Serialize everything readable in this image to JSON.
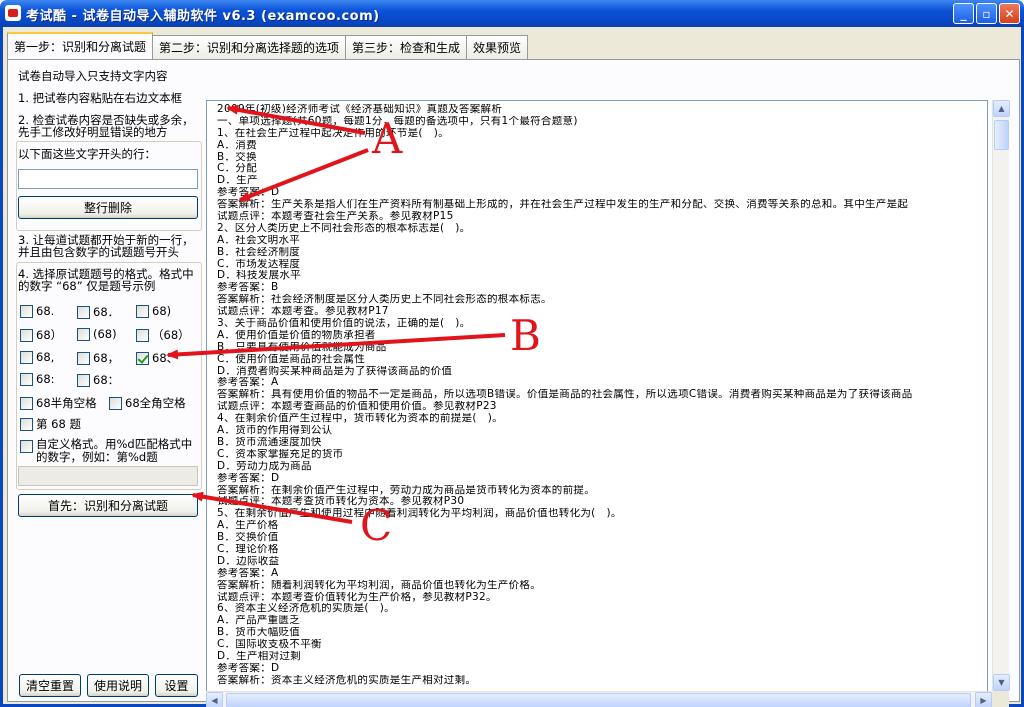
{
  "window": {
    "title": "考试酷 - 试卷自动导入辅助软件 v6.3 (examcoo.com)",
    "min_glyph": "_",
    "max_glyph": "▫",
    "close_glyph": "✕"
  },
  "tabs": [
    {
      "label": "第一步：识别和分离试题",
      "active": true
    },
    {
      "label": "第二步：识别和分离选择题的选项",
      "active": false
    },
    {
      "label": "第三步：检查和生成",
      "active": false
    },
    {
      "label": "效果预览",
      "active": false
    }
  ],
  "left": {
    "intro": "试卷自动导入只支持文字内容",
    "step1": "1. 把试卷内容粘贴在右边文本框",
    "step2_line1": "2. 检查试卷内容是否缺失或多余，",
    "step2_line2": "先手工修改好明显错误的地方",
    "delete_label": "以下面这些文字开头的行：",
    "delete_input_value": "",
    "delete_button": "整行删除",
    "step3_line1": "3. 让每道试题都开始于新的一行，",
    "step3_line2": "并且由包含数字的试题题号开头",
    "step4_line1": "4. 选择原试题题号的格式。格式中",
    "step4_line2": "的数字 “68” 仅是题号示例",
    "formats": [
      {
        "label": "68.",
        "checked": false
      },
      {
        "label": "68．",
        "checked": false
      },
      {
        "label": "68)",
        "checked": false
      },
      {
        "label": "68）",
        "checked": false
      },
      {
        "label": "(68)",
        "checked": false
      },
      {
        "label": "（68）",
        "checked": false
      },
      {
        "label": "68,",
        "checked": false
      },
      {
        "label": "68，",
        "checked": false
      },
      {
        "label": "68、",
        "checked": true
      },
      {
        "label": "68:",
        "checked": false
      },
      {
        "label": "68：",
        "checked": false
      }
    ],
    "half_space": {
      "label": "68半角空格",
      "checked": false
    },
    "full_space": {
      "label": "68全角空格",
      "checked": false
    },
    "di_ti": {
      "label": "第 68 题",
      "checked": false
    },
    "custom_line1": "自定义格式。用%d匹配格式中",
    "custom_line2": "的数字，例如：第%d题",
    "custom_checked": false,
    "custom_input_value": "",
    "recognize_button": "首先：识别和分离试题",
    "reset_button": "清空重置",
    "help_button": "使用说明",
    "settings_button": "设置"
  },
  "editor": {
    "lines": [
      "2009年(初级)经济师考试《经济基础知识》真题及答案解析",
      "一、单项选择题(共60题，每题1分，每题的备选项中，只有1个最符合题意)",
      "1、在社会生产过程中起决定作用的环节是(   )。",
      "A．消费",
      "B．交换",
      "C．分配",
      "D．生产",
      "参考答案：D",
      "答案解析：生产关系是指人们在生产资料所有制基础上形成的，并在社会生产过程中发生的生产和分配、交换、消费等关系的总和。其中生产是起",
      "试题点评：本题考查社会生产关系。参见教材P15",
      "2、区分人类历史上不同社会形态的根本标志是(   )。",
      "A．社会文明水平",
      "B．社会经济制度",
      "C．市场发达程度",
      "D．科技发展水平",
      "参考答案：B",
      "答案解析：社会经济制度是区分人类历史上不同社会形态的根本标志。",
      "试题点评：本题考查。参见教材P17",
      "3、关于商品价值和使用价值的说法，正确的是(   )。",
      "A．使用价值是价值的物质承担者",
      "B．只要具有使用价值就能成为商品",
      "C．使用价值是商品的社会属性",
      "D．消费者购买某种商品是为了获得该商品的价值",
      "参考答案：A",
      "答案解析：具有使用价值的物品不一定是商品，所以选项B错误。价值是商品的社会属性，所以选项C错误。消费者购买某种商品是为了获得该商品",
      "试题点评：本题考查商品的价值和使用价值。参见教材P23",
      "4、在剩余价值产生过程中，货币转化为资本的前提是(   )。",
      "A．货币的作用得到公认",
      "B．货币流通速度加快",
      "C．资本家掌握充足的货币",
      "D．劳动力成为商品",
      "参考答案：D",
      "答案解析：在剩余价值产生过程中，劳动力成为商品是货币转化为资本的前提。",
      "试题点评：本题考查货币转化为资本。参见教材P30",
      "5、在剩余价值产生和使用过程中随着利润转化为平均利润，商品价值也转化为(   )。",
      "A．生产价格",
      "B．交换价值",
      "C．理论价格",
      "D．边际收益",
      "参考答案：A",
      "答案解析：随着利润转化为平均利润，商品价值也转化为生产价格。",
      "试题点评：本题考查价值转化为生产价格，参见教材P32。",
      "6、资本主义经济危机的实质是(   )。",
      "A．产品严重匮乏",
      "B．货币大幅贬值",
      "C．国际收支极不平衡",
      "D．生产相对过剩",
      "参考答案：D",
      "答案解析：资本主义经济危机的实质是生产相对过剩。"
    ]
  },
  "annotations": {
    "a": "A",
    "b": "B",
    "c": "C",
    "color": "#e0141a"
  }
}
